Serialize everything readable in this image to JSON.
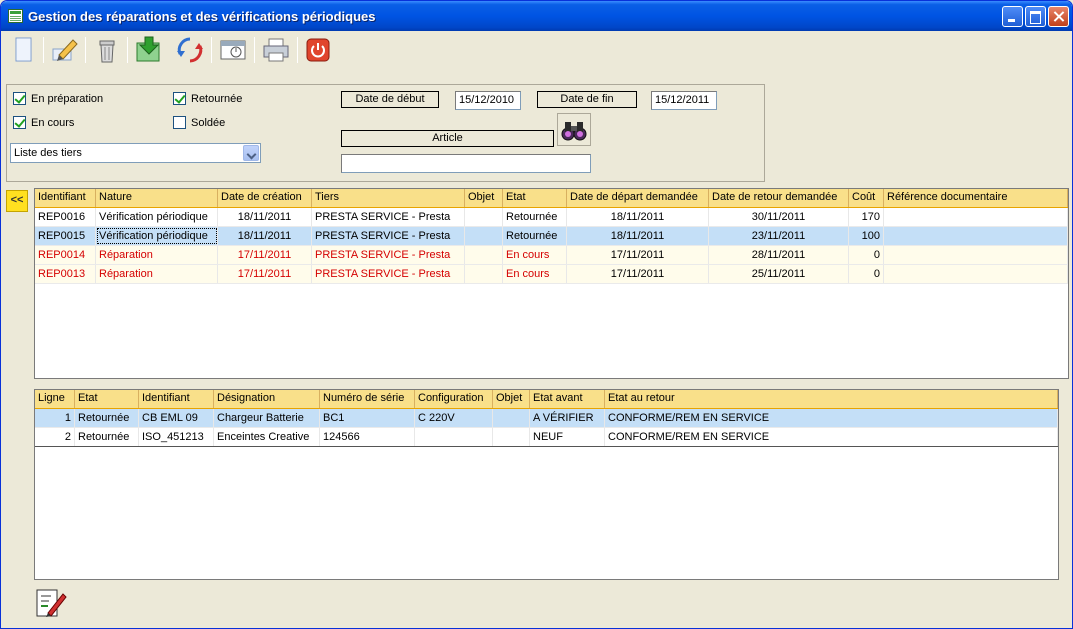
{
  "window": {
    "title": "Gestion des réparations et des vérifications périodiques"
  },
  "filters": {
    "checkboxes": [
      {
        "label": "En préparation",
        "checked": true
      },
      {
        "label": "En cours",
        "checked": true
      },
      {
        "label": "Retournée",
        "checked": true
      },
      {
        "label": "Soldée",
        "checked": false
      }
    ],
    "tiers_combo": "Liste des tiers",
    "date_debut_label": "Date de début",
    "date_debut_value": "15/12/2010",
    "date_fin_label": "Date de fin",
    "date_fin_value": "15/12/2011",
    "article_label": "Article",
    "article_value": ""
  },
  "collapse_label": "<<",
  "repairs": {
    "columns": [
      "Identifiant",
      "Nature",
      "Date de création",
      "Tiers",
      "Objet",
      "Etat",
      "Date de départ demandée",
      "Date de retour demandée",
      "Coût",
      "Référence documentaire"
    ],
    "rows": [
      {
        "id": "REP0016",
        "nature": "Vérification périodique",
        "created": "18/11/2011",
        "tiers": "PRESTA SERVICE - Presta",
        "objet": "",
        "etat": "Retournée",
        "depart": "18/11/2011",
        "retour": "30/11/2011",
        "cout": "170",
        "ref": ""
      },
      {
        "id": "REP0015",
        "nature": "Vérification périodique",
        "created": "18/11/2011",
        "tiers": "PRESTA SERVICE - Presta",
        "objet": "",
        "etat": "Retournée",
        "depart": "18/11/2011",
        "retour": "23/11/2011",
        "cout": "100",
        "ref": ""
      },
      {
        "id": "REP0014",
        "nature": "Réparation",
        "created": "17/11/2011",
        "tiers": "PRESTA SERVICE - Presta",
        "objet": "",
        "etat": "En cours",
        "depart": "17/11/2011",
        "retour": "28/11/2011",
        "cout": "0",
        "ref": ""
      },
      {
        "id": "REP0013",
        "nature": "Réparation",
        "created": "17/11/2011",
        "tiers": "PRESTA SERVICE - Presta",
        "objet": "",
        "etat": "En cours",
        "depart": "17/11/2011",
        "retour": "25/11/2011",
        "cout": "0",
        "ref": ""
      }
    ]
  },
  "lines": {
    "columns": [
      "Ligne",
      "Etat",
      "Identifiant",
      "Désignation",
      "Numéro de série",
      "Configuration",
      "Objet",
      "Etat avant",
      "Etat au retour"
    ],
    "rows": [
      {
        "ligne": "1",
        "etat": "Retournée",
        "id": "CB EML 09",
        "designation": "Chargeur Batterie",
        "serie": "BC1",
        "config": "C 220V",
        "objet": "",
        "avant": "A VÉRIFIER",
        "retour": "CONFORME/REM EN SERVICE"
      },
      {
        "ligne": "2",
        "etat": "Retournée",
        "id": "ISO_451213",
        "designation": "Enceintes Creative",
        "serie": "124566",
        "config": "",
        "objet": "",
        "avant": "NEUF",
        "retour": "CONFORME/REM EN SERVICE"
      }
    ]
  },
  "colors": {
    "header_bg": "#F9E08A",
    "selection": "#C4DFF7",
    "alert_text": "#D50000",
    "titlebar": "#0054E3"
  }
}
